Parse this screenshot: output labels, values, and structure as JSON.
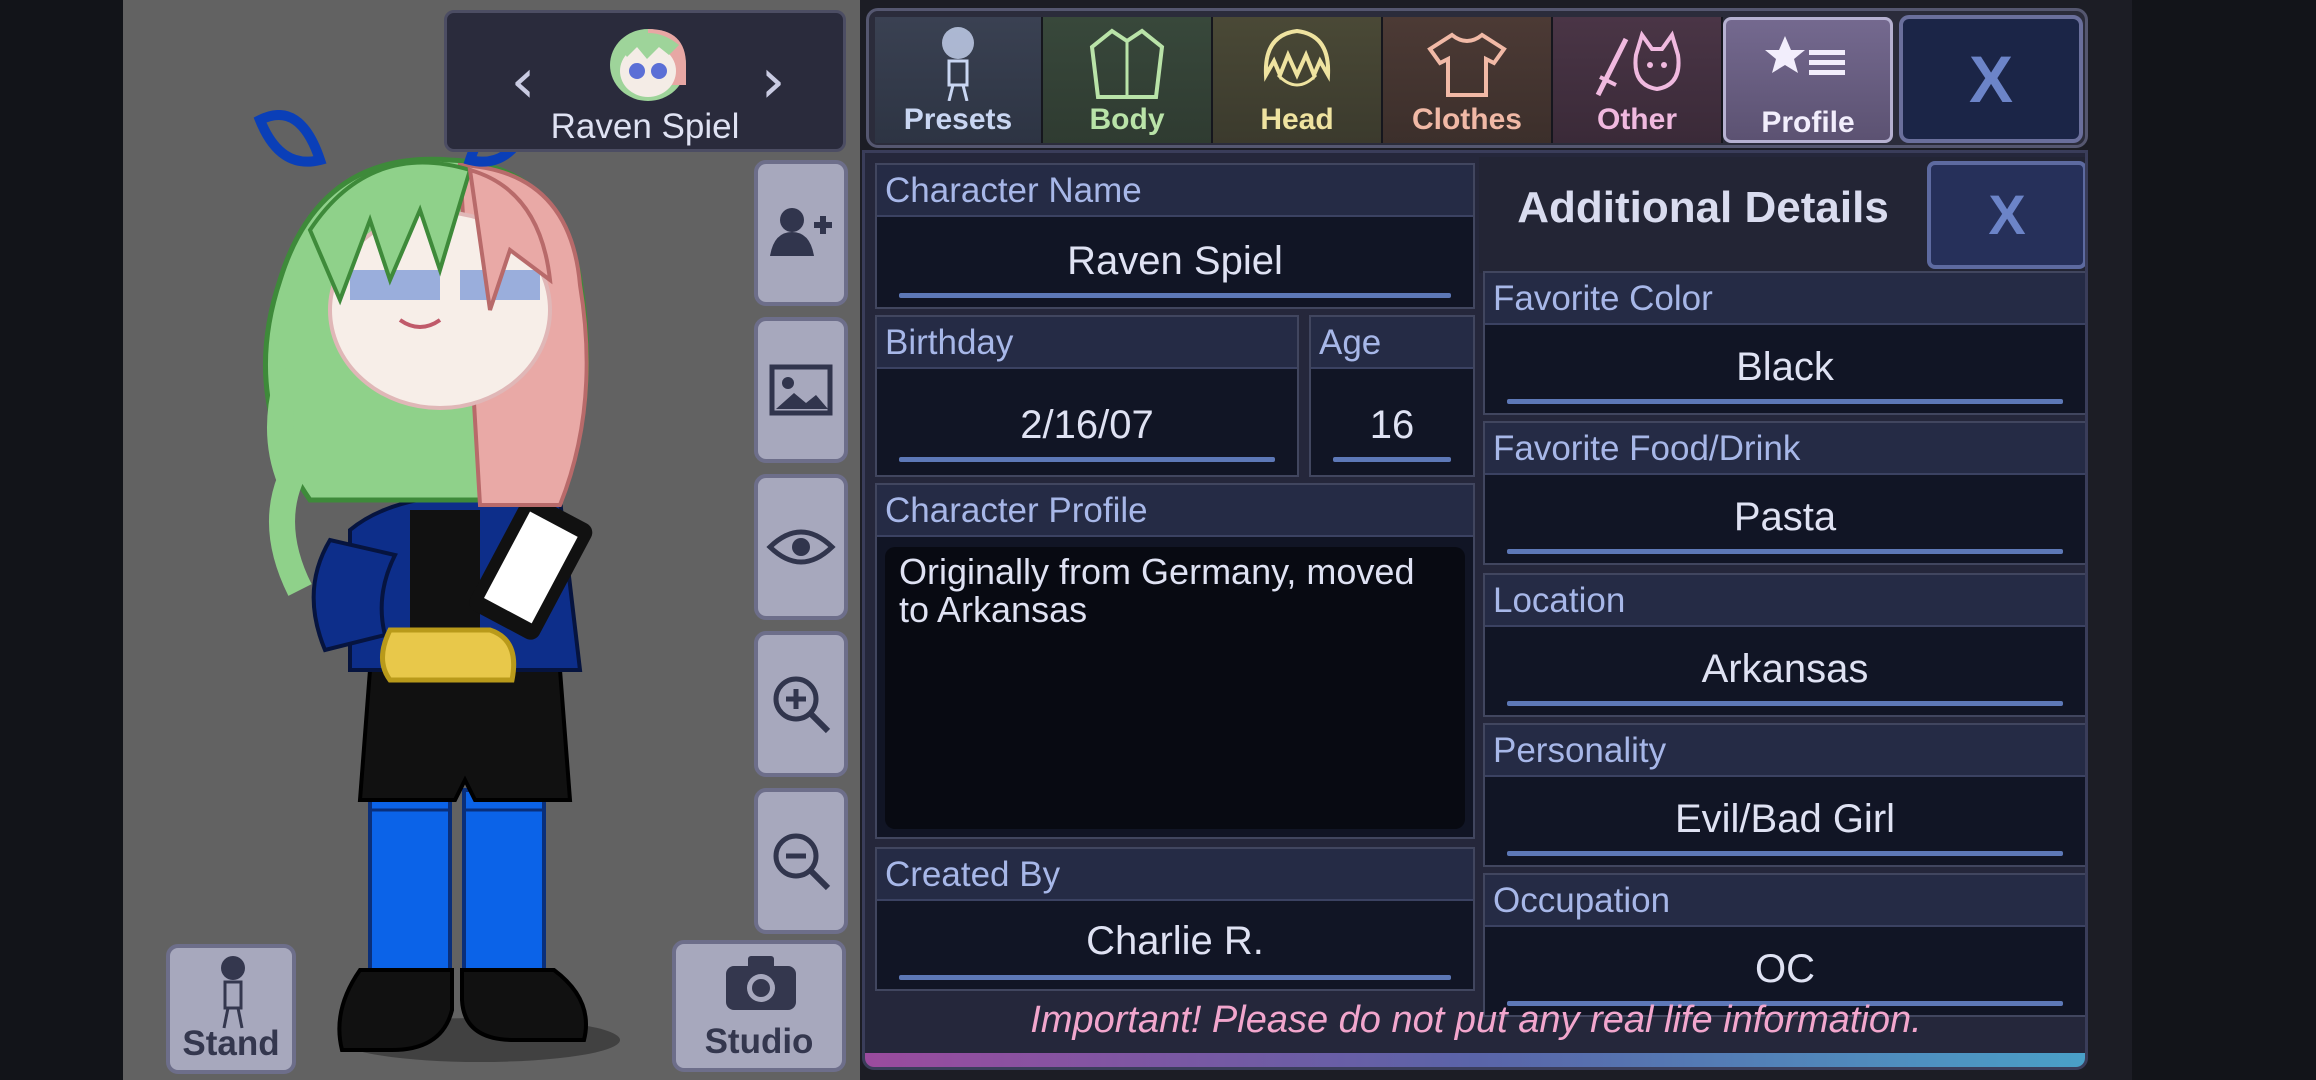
{
  "character_card": {
    "name": "Raven Spiel",
    "prev_icon": "chevron-left-icon",
    "next_icon": "chevron-right-icon"
  },
  "tools": [
    {
      "id": "add-character",
      "icon": "add-person-icon"
    },
    {
      "id": "background",
      "icon": "image-icon"
    },
    {
      "id": "visibility",
      "icon": "eye-icon"
    },
    {
      "id": "zoom-in",
      "icon": "zoom-in-icon"
    },
    {
      "id": "zoom-out",
      "icon": "zoom-out-icon"
    }
  ],
  "bottom_buttons": {
    "stand_label": "Stand",
    "studio_label": "Studio"
  },
  "tabs": [
    {
      "label": "Presets",
      "icon": "preset-figure-icon",
      "color": "#c9d6f2"
    },
    {
      "label": "Body",
      "icon": "jacket-icon",
      "color": "#b9e3a8"
    },
    {
      "label": "Head",
      "icon": "hair-icon",
      "color": "#efe3a0"
    },
    {
      "label": "Clothes",
      "icon": "tshirt-icon",
      "color": "#f1b9a6"
    },
    {
      "label": "Other",
      "icon": "sword-cat-icon",
      "color": "#f0b9df"
    },
    {
      "label": "Profile",
      "icon": "star-list-icon",
      "color": "#f2eefc"
    }
  ],
  "close_label": "X",
  "profile": {
    "character_name_label": "Character Name",
    "character_name": "Raven Spiel",
    "birthday_label": "Birthday",
    "birthday": "2/16/07",
    "age_label": "Age",
    "age": "16",
    "character_profile_label": "Character Profile",
    "character_profile": "Originally from Germany, moved to Arkansas",
    "created_by_label": "Created By",
    "created_by": "Charlie R."
  },
  "additional": {
    "title": "Additional Details",
    "close_label": "X",
    "favorite_color_label": "Favorite Color",
    "favorite_color": "Black",
    "favorite_food_label": "Favorite Food/Drink",
    "favorite_food": "Pasta",
    "location_label": "Location",
    "location": "Arkansas",
    "personality_label": "Personality",
    "personality": "Evil/Bad Girl",
    "occupation_label": "Occupation",
    "occupation": "OC"
  },
  "warning": "Important! Please do not put any real life information."
}
